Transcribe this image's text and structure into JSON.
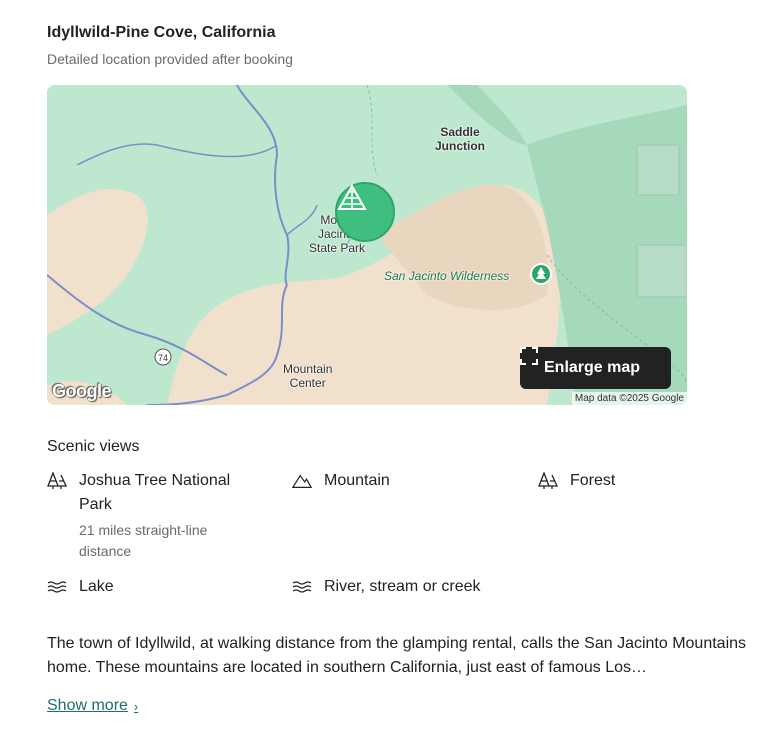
{
  "location": {
    "title": "Idyllwild-Pine Cove, California",
    "subtitle": "Detailed location provided after booking"
  },
  "map": {
    "labels": {
      "saddle_junction": "Saddle\nJunction",
      "state_park": "Mount\nJacinto\nState Park",
      "wilderness": "San Jacinto Wilderness",
      "mountain_center": "Mountain\nCenter",
      "route": "74"
    },
    "enlarge_label": "Enlarge map",
    "google_logo": "Google",
    "attribution": "Map data ©2025 Google",
    "colors": {
      "forest": "#b9e6cc",
      "desert": "#f0e0cc",
      "water": "#7a8fc9"
    }
  },
  "scenic": {
    "heading": "Scenic views",
    "items": [
      {
        "icon": "trees-icon",
        "label": "Joshua Tree National Park",
        "sub": "21 miles straight-line distance"
      },
      {
        "icon": "mountain-icon",
        "label": "Mountain",
        "sub": ""
      },
      {
        "icon": "trees-icon",
        "label": "Forest",
        "sub": ""
      },
      {
        "icon": "waves-icon",
        "label": "Lake",
        "sub": ""
      },
      {
        "icon": "waves-icon",
        "label": "River, stream or creek",
        "sub": ""
      }
    ]
  },
  "description": {
    "text": "The town of Idyllwild, at walking distance from the glamping rental, calls the San Jacinto Mountains home. These mountains are located in southern California, just east of famous Los…",
    "show_more": "Show more"
  }
}
